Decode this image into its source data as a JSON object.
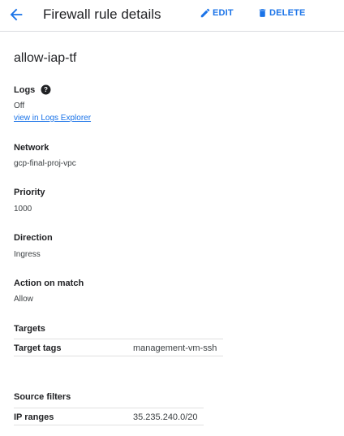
{
  "header": {
    "title": "Firewall rule details",
    "edit_label": "EDIT",
    "delete_label": "DELETE"
  },
  "rule": {
    "name": "allow-iap-tf"
  },
  "logs": {
    "label": "Logs",
    "value": "Off",
    "link": "view in Logs Explorer"
  },
  "network": {
    "label": "Network",
    "value": "gcp-final-proj-vpc"
  },
  "priority": {
    "label": "Priority",
    "value": "1000"
  },
  "direction": {
    "label": "Direction",
    "value": "Ingress"
  },
  "action": {
    "label": "Action on match",
    "value": "Allow"
  },
  "targets": {
    "label": "Targets",
    "key": "Target tags",
    "value": "management-vm-ssh"
  },
  "source_filters": {
    "label": "Source filters",
    "key": "IP ranges",
    "value": "35.235.240.0/20"
  },
  "colors": {
    "accent": "#1a73e8",
    "text": "#202124",
    "divider": "#e0e0e0"
  },
  "icons": {
    "back": "arrow-back-icon",
    "edit": "pencil-icon",
    "delete": "trash-icon",
    "help": "help-icon"
  }
}
